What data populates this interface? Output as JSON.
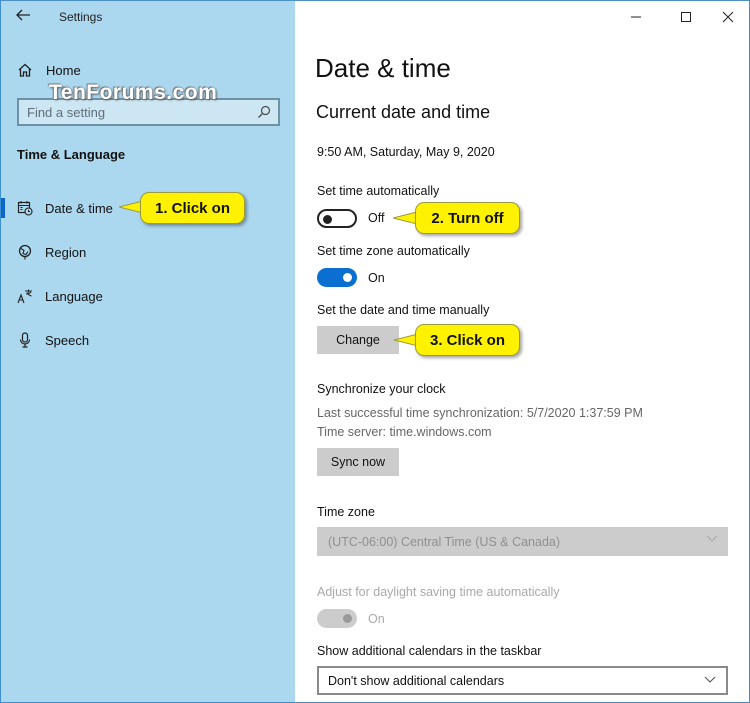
{
  "window": {
    "title": "Settings",
    "controls": {
      "minimize": "minimize",
      "maximize": "maximize",
      "close": "close"
    }
  },
  "sidebar": {
    "home_label": "Home",
    "search_placeholder": "Find a setting",
    "section_heading": "Time & Language",
    "items": [
      {
        "label": "Date & time",
        "icon": "calendar-clock-icon",
        "active": true
      },
      {
        "label": "Region",
        "icon": "globe-icon",
        "active": false
      },
      {
        "label": "Language",
        "icon": "language-icon",
        "active": false
      },
      {
        "label": "Speech",
        "icon": "microphone-icon",
        "active": false
      }
    ]
  },
  "watermark": "TenForums.com",
  "main": {
    "page_title": "Date & time",
    "current_section": "Current date and time",
    "current_datetime": "9:50 AM, Saturday, May 9, 2020",
    "set_time_auto": {
      "label": "Set time automatically",
      "state": "Off",
      "on": false
    },
    "set_timezone_auto": {
      "label": "Set time zone automatically",
      "state": "On",
      "on": true
    },
    "manual": {
      "label": "Set the date and time manually",
      "button": "Change"
    },
    "sync": {
      "heading": "Synchronize your clock",
      "last_sync": "Last successful time synchronization: 5/7/2020 1:37:59 PM",
      "server": "Time server: time.windows.com",
      "button": "Sync now"
    },
    "timezone": {
      "label": "Time zone",
      "value": "(UTC-06:00) Central Time (US & Canada)",
      "disabled": true
    },
    "dst": {
      "label": "Adjust for daylight saving time automatically",
      "state": "On",
      "disabled": true
    },
    "calendars": {
      "label": "Show additional calendars in the taskbar",
      "value": "Don't show additional calendars"
    }
  },
  "callouts": {
    "step1": "1. Click on",
    "step2": "2. Turn off",
    "step3": "3. Click on"
  },
  "colors": {
    "sidebar_bg": "#acd8ef",
    "accent": "#0a6fd0",
    "callout": "#fff200"
  }
}
